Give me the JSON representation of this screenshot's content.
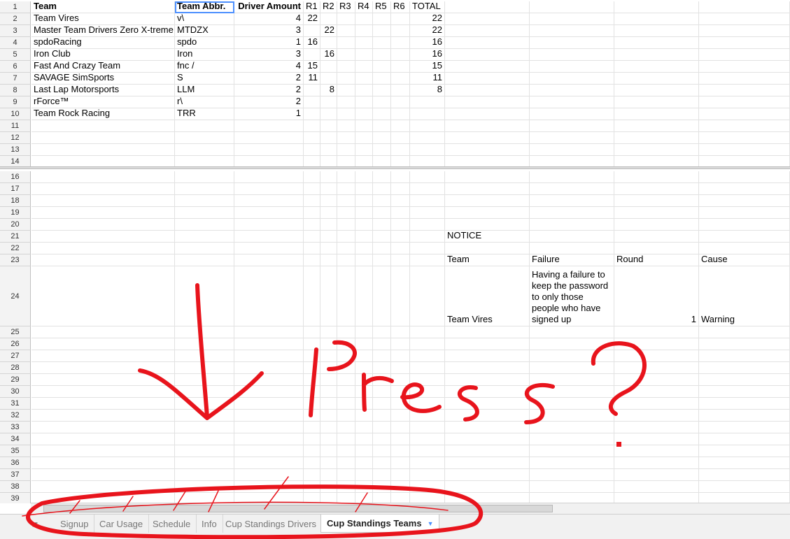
{
  "sheet": {
    "rows": [
      {
        "n": "1",
        "cells": [
          "Team",
          "Team Abbr.",
          "Driver Amount",
          "R1",
          "R2",
          "R3",
          "R4",
          "R5",
          "R6",
          "TOTAL"
        ]
      },
      {
        "n": "2",
        "cells": [
          "Team Vires",
          "v\\",
          "4",
          "22",
          "",
          "",
          "",
          "",
          "",
          "22"
        ]
      },
      {
        "n": "3",
        "cells": [
          "Master Team Drivers Zero X-treme",
          "MTDZX",
          "3",
          "",
          "22",
          "",
          "",
          "",
          "",
          "22"
        ]
      },
      {
        "n": "4",
        "cells": [
          "spdoRacing",
          "spdo",
          "1",
          "16",
          "",
          "",
          "",
          "",
          "",
          "16"
        ]
      },
      {
        "n": "5",
        "cells": [
          "Iron Club",
          "Iron",
          "3",
          "",
          "16",
          "",
          "",
          "",
          "",
          "16"
        ]
      },
      {
        "n": "6",
        "cells": [
          "Fast And Crazy Team",
          "fnc /",
          "4",
          "15",
          "",
          "",
          "",
          "",
          "",
          "15"
        ]
      },
      {
        "n": "7",
        "cells": [
          "SAVAGE SimSports",
          "S",
          "2",
          "11",
          "",
          "",
          "",
          "",
          "",
          "11"
        ]
      },
      {
        "n": "8",
        "cells": [
          "Last Lap Motorsports",
          "LLM",
          "2",
          "",
          "8",
          "",
          "",
          "",
          "",
          "8"
        ]
      },
      {
        "n": "9",
        "cells": [
          "rForce™",
          "r\\",
          "2",
          "",
          "",
          "",
          "",
          "",
          "",
          ""
        ]
      },
      {
        "n": "10",
        "cells": [
          "Team Rock Racing",
          "TRR",
          "1",
          "",
          "",
          "",
          "",
          "",
          "",
          ""
        ]
      }
    ],
    "empty_rows_top": [
      "11",
      "12",
      "13",
      "14"
    ],
    "empty_rows_bottom": [
      "16",
      "17",
      "18",
      "19",
      "20",
      "22",
      "25",
      "26",
      "27",
      "28",
      "29",
      "30",
      "31",
      "32",
      "33",
      "34",
      "35",
      "36",
      "37",
      "38",
      "39"
    ],
    "notice": {
      "row21": "21",
      "title": "NOTICE",
      "row23": "23",
      "headers": [
        "Team",
        "Failure",
        "Round",
        "Cause"
      ],
      "row24": "24",
      "entry": {
        "team": "Team Vires",
        "failure": "Having a failure to keep the password to only those people who have signed up",
        "round": "1",
        "cause": "Warning"
      }
    }
  },
  "tabs": [
    {
      "label": "Signup",
      "active": false
    },
    {
      "label": "Car Usage",
      "active": false
    },
    {
      "label": "Schedule",
      "active": false
    },
    {
      "label": "Info",
      "active": false
    },
    {
      "label": "Cup Standings Drivers",
      "active": false
    },
    {
      "label": "Cup Standings Teams",
      "active": true
    }
  ],
  "annotation": {
    "text": "Press?",
    "color": "#e8141c"
  },
  "icons": {
    "menu": "menu-icon",
    "dropdown": "dropdown-arrow-icon"
  }
}
